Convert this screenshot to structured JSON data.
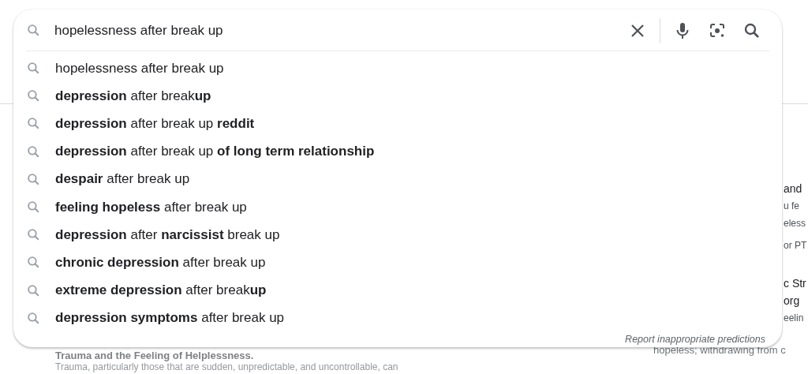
{
  "search": {
    "value": "hopelessness after break up"
  },
  "suggestions": [
    {
      "text": "hopelessness after break up"
    },
    {
      "text": "**depression** after break**up**"
    },
    {
      "text": "**depression** after break up **reddit**"
    },
    {
      "text": "**depression** after break up **of long term relationship**"
    },
    {
      "text": "**despair** after break up"
    },
    {
      "text": "**feeling hopeless** after break up"
    },
    {
      "text": "**depression** after **narcissist** break up"
    },
    {
      "text": "**chronic depression** after break up"
    },
    {
      "text": "**extreme depression** after break**up**"
    },
    {
      "text": "**depression symptoms** after break up"
    }
  ],
  "report_link": "Report inappropriate predictions",
  "background": {
    "left": [
      {
        "kind": "heading",
        "text": "Trauma and the Feeling of Helplessness."
      },
      {
        "kind": "body",
        "text": "Trauma, particularly those that are sudden, unpredictable, and uncontrollable, can"
      }
    ],
    "right": [
      {
        "kind": "title",
        "text": "and"
      },
      {
        "kind": "snippet",
        "text": "u fe"
      },
      {
        "kind": "snippet",
        "text": "eless"
      },
      {
        "kind": "source",
        "text": "or PT"
      },
      {
        "kind": "title",
        "text": "c Str"
      },
      {
        "kind": "title",
        "text": "org"
      },
      {
        "kind": "snippet",
        "text": "eelin"
      },
      {
        "kind": "wide",
        "text": "hopeless; withdrawing from c"
      }
    ]
  }
}
